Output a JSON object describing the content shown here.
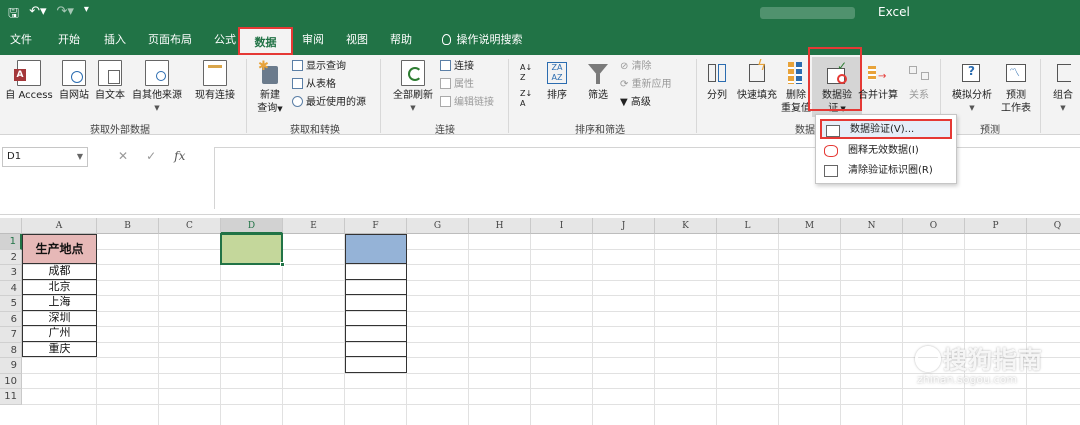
{
  "app": {
    "title": "Excel"
  },
  "qat": {
    "save_icon": "save-icon",
    "undo_icon": "undo-icon",
    "redo_icon": "redo-icon",
    "customize_icon": "customize-qat-icon"
  },
  "tabs": [
    {
      "label": "文件"
    },
    {
      "label": "开始"
    },
    {
      "label": "插入"
    },
    {
      "label": "页面布局"
    },
    {
      "label": "公式"
    },
    {
      "label": "数据"
    },
    {
      "label": "审阅"
    },
    {
      "label": "视图"
    },
    {
      "label": "帮助"
    },
    {
      "label": "操作说明搜索"
    }
  ],
  "ribbon": {
    "get_external": {
      "label": "获取外部数据",
      "buttons": [
        "自 Access",
        "自网站",
        "自文本",
        "自其他来源",
        "现有连接"
      ]
    },
    "get_transform": {
      "label": "获取和转换",
      "new_query_1": "新建",
      "new_query_2": "查询",
      "show_query": "显示查询",
      "from_table": "从表格",
      "recent_sources": "最近使用的源"
    },
    "connections": {
      "label": "连接",
      "refresh_all": "全部刷新",
      "connections": "连接",
      "properties": "属性",
      "edit_links": "编辑链接"
    },
    "sort_filter": {
      "label": "排序和筛选",
      "sort": "排序",
      "filter": "筛选",
      "clear": "清除",
      "reapply": "重新应用",
      "advanced": "高级"
    },
    "data_tools": {
      "label": "数据",
      "text_to_columns": "分列",
      "flash_fill": "快速填充",
      "remove_dup_1": "删除",
      "remove_dup_2": "重复值",
      "validation_1": "数据验",
      "validation_2": "证",
      "consolidate": "合并计算",
      "relationships": "关系"
    },
    "forecast": {
      "label": "预测",
      "whatif": "模拟分析",
      "forecast_1": "预测",
      "forecast_2": "工作表"
    },
    "outline": {
      "group": "组合"
    }
  },
  "menu": {
    "items": [
      "数据验证(V)...",
      "圈释无效数据(I)",
      "清除验证标识圈(R)"
    ]
  },
  "formula_bar": {
    "name_box": "D1",
    "cancel": "✕",
    "enter": "✓",
    "fx": "fx",
    "value": ""
  },
  "sheet": {
    "columns": [
      "A",
      "B",
      "C",
      "D",
      "E",
      "F",
      "G",
      "H",
      "I",
      "J",
      "K",
      "L",
      "M",
      "N",
      "O",
      "P",
      "Q"
    ],
    "rows": [
      "1",
      "2",
      "3",
      "4",
      "5",
      "6",
      "7",
      "8",
      "9",
      "10",
      "11"
    ],
    "a1": "生产地点",
    "a_values": [
      "成都",
      "北京",
      "上海",
      "深圳",
      "广州",
      "重庆"
    ],
    "colors": {
      "a1_fill": "#e6b8b7",
      "d1_fill": "#c4d79b",
      "f1_fill": "#95b3d7",
      "accent": "#217346",
      "highlight": "#e53935"
    }
  },
  "watermark": {
    "text": "搜狗指南",
    "sub": "zhinan.sogou.com"
  }
}
